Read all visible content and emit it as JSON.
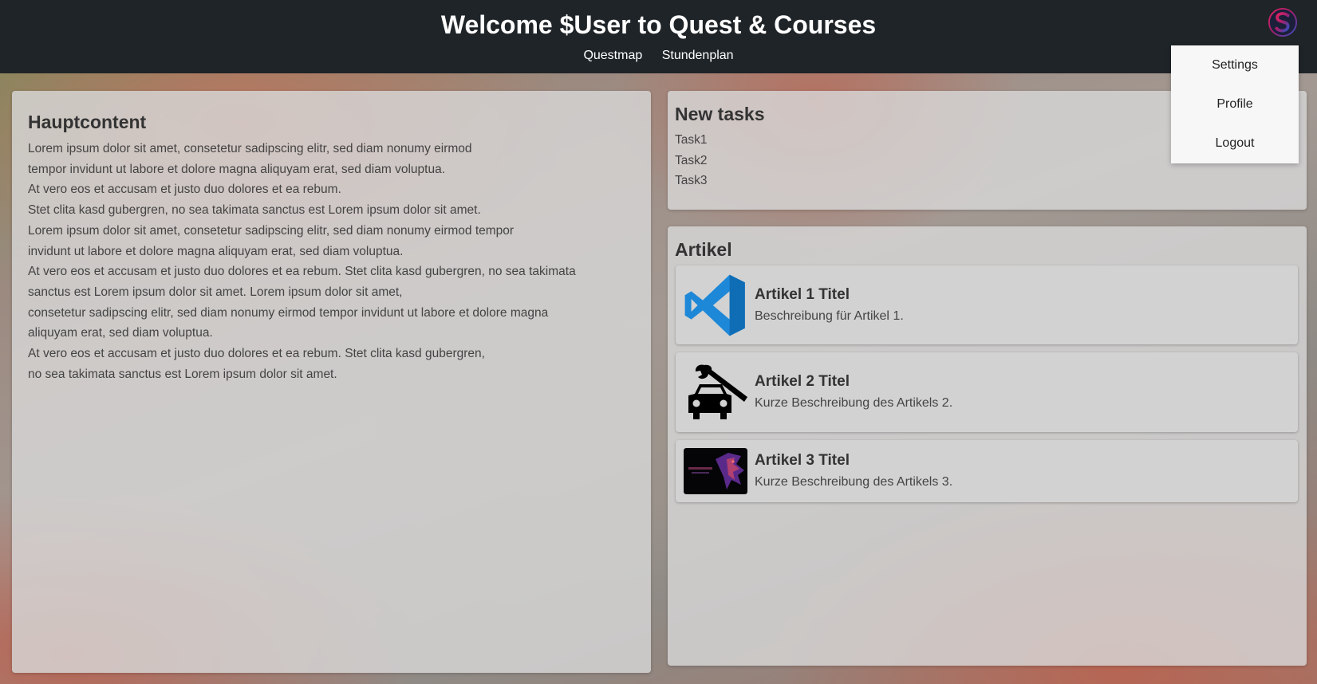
{
  "header": {
    "title": "Welcome $User to Quest & Courses",
    "nav": [
      "Questmap",
      "Stundenplan"
    ],
    "avatar_icon": "s-logo-icon"
  },
  "user_menu": {
    "items": [
      "Settings",
      "Profile",
      "Logout"
    ]
  },
  "main": {
    "title": "Hauptcontent",
    "lines": [
      "Lorem ipsum dolor sit amet, consetetur sadipscing elitr, sed diam nonumy eirmod",
      "tempor invidunt ut labore et dolore magna aliquyam erat, sed diam voluptua.",
      "At vero eos et accusam et justo duo dolores et ea rebum.",
      "Stet clita kasd gubergren, no sea takimata sanctus est Lorem ipsum dolor sit amet.",
      "Lorem ipsum dolor sit amet, consetetur sadipscing elitr, sed diam nonumy eirmod tempor",
      "invidunt ut labore et dolore magna aliquyam erat, sed diam voluptua.",
      "At vero eos et accusam et justo duo dolores et ea rebum. Stet clita kasd gubergren, no sea takimata",
      "sanctus est Lorem ipsum dolor sit amet. Lorem ipsum dolor sit amet,",
      "consetetur sadipscing elitr, sed diam nonumy eirmod tempor invidunt ut labore et dolore magna",
      "aliquyam erat, sed diam voluptua.",
      "At vero eos et accusam et justo duo dolores et ea rebum. Stet clita kasd gubergren,",
      "no sea takimata sanctus est Lorem ipsum dolor sit amet."
    ]
  },
  "tasks": {
    "title": "New tasks",
    "items": [
      "Task1",
      "Task2",
      "Task3"
    ]
  },
  "articles": {
    "title": "Artikel",
    "items": [
      {
        "title": "Artikel 1 Titel",
        "description": "Beschreibung für Artikel 1.",
        "icon": "vscode-icon"
      },
      {
        "title": "Artikel 2 Titel",
        "description": "Kurze Beschreibung des Artikels 2.",
        "icon": "car-repair-icon"
      },
      {
        "title": "Artikel 3 Titel",
        "description": "Kurze Beschreibung des Artikels 3.",
        "icon": "eagle-image"
      }
    ]
  },
  "colors": {
    "header_bg": "#1f2428",
    "vscode_blue": "#1e88d8",
    "dropdown_bg": "#f7f7f7"
  }
}
